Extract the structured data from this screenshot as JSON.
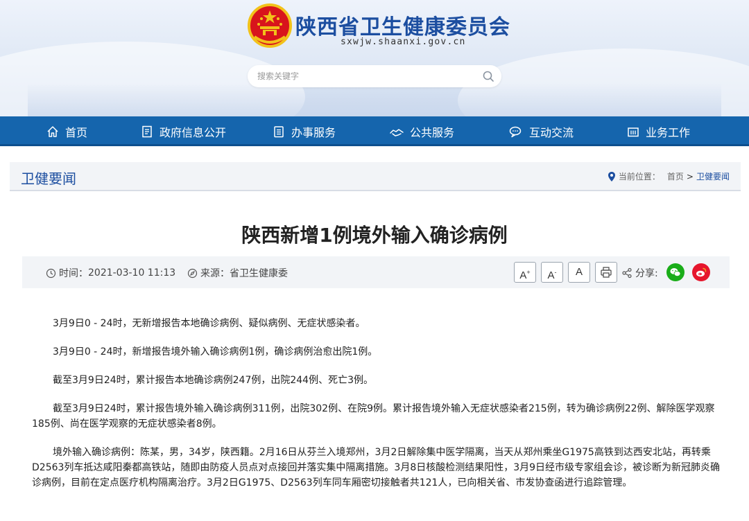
{
  "site": {
    "title": "陕西省卫生健康委员会",
    "domain": "sxwjw.shaanxi.gov.cn",
    "search_placeholder": "搜索关键字"
  },
  "nav": {
    "items": [
      {
        "label": "首页",
        "icon": "home-icon"
      },
      {
        "label": "政府信息公开",
        "icon": "document-list-icon"
      },
      {
        "label": "办事服务",
        "icon": "clipboard-icon"
      },
      {
        "label": "公共服务",
        "icon": "handshake-icon"
      },
      {
        "label": "互动交流",
        "icon": "chat-bubble-icon"
      },
      {
        "label": "业务工作",
        "icon": "briefcase-icon"
      }
    ]
  },
  "section": {
    "title": "卫健要闻",
    "location_label": "当前位置：",
    "crumb_home": "首页",
    "crumb_sep": ">",
    "crumb_current": "卫健要闻"
  },
  "article": {
    "title": "陕西新增1例境外输入确诊病例",
    "time_label": "时间：",
    "time": "2021-03-10 11:13",
    "source_label": "来源：",
    "source": "省卫生健康委",
    "font_increase": "A",
    "font_decrease": "A",
    "font_reset": "A",
    "share_label": "分享:",
    "paragraphs": [
      "3月9日0 - 24时，无新增报告本地确诊病例、疑似病例、无症状感染者。",
      "3月9日0 - 24时，新增报告境外输入确诊病例1例，确诊病例治愈出院1例。",
      "截至3月9日24时，累计报告本地确诊病例247例，出院244例、死亡3例。",
      "截至3月9日24时，累计报告境外输入确诊病例311例，出院302例、在院9例。累计报告境外输入无症状感染者215例，转为确诊病例22例、解除医学观察185例、尚在医学观察的无症状感染者8例。",
      "境外输入确诊病例：陈某，男，34岁，陕西籍。2月16日从芬兰入境郑州，3月2日解除集中医学隔离，当天从郑州乘坐G1975高铁到达西安北站，再转乘D2563列车抵达咸阳秦都高铁站，随即由防疫人员点对点接回并落实集中隔离措施。3月8日核酸检测结果阳性，3月9日经市级专家组会诊，被诊断为新冠肺炎确诊病例，目前在定点医疗机构隔离治疗。3月2日G1975、D2563列车同车厢密切接触者共121人，已向相关省、市发协查函进行追踪管理。"
    ]
  },
  "colors": {
    "brand_blue": "#1565ad",
    "title_blue": "#1c4ea0",
    "wechat_green": "#1aad19",
    "weibo_red": "#e6162d"
  }
}
